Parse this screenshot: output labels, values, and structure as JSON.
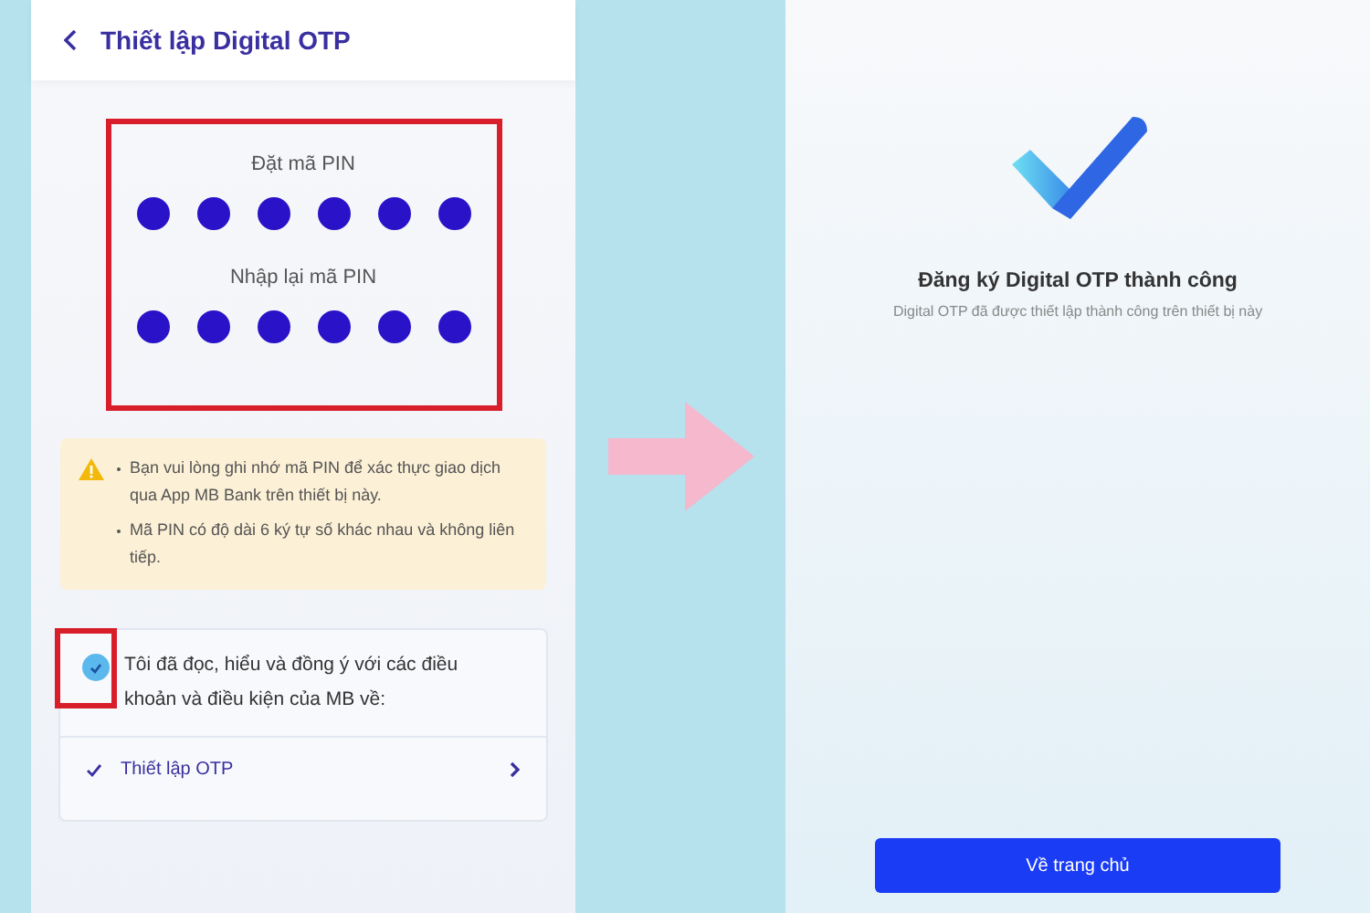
{
  "setup_screen": {
    "title": "Thiết lập Digital OTP",
    "pin_fields": [
      {
        "label": "Đặt mã PIN",
        "digits": [
          {
            "filled": true
          },
          {
            "filled": true
          },
          {
            "filled": true
          },
          {
            "filled": true
          },
          {
            "filled": true
          },
          {
            "filled": true
          }
        ]
      },
      {
        "label": "Nhập lại mã PIN",
        "digits": [
          {
            "filled": true
          },
          {
            "filled": true
          },
          {
            "filled": true
          },
          {
            "filled": true
          },
          {
            "filled": true
          },
          {
            "filled": true
          }
        ]
      }
    ],
    "notes": [
      "Bạn vui lòng ghi nhớ mã PIN để xác thực giao dịch qua App MB Bank trên thiết bị này.",
      "Mã PIN có độ dài 6 ký tự số khác nhau và không liên tiếp."
    ],
    "agreement": {
      "checked": true,
      "text": "Tôi đã đọc, hiểu và đồng ý với các điều khoản và điều kiện của MB về:",
      "items": [
        {
          "label": "Thiết lập OTP",
          "checked": true
        }
      ]
    }
  },
  "success_screen": {
    "title": "Đăng ký Digital OTP thành công",
    "subtitle": "Digital OTP đã được thiết lập thành công trên thiết bị này",
    "button": "Về trang chủ"
  }
}
